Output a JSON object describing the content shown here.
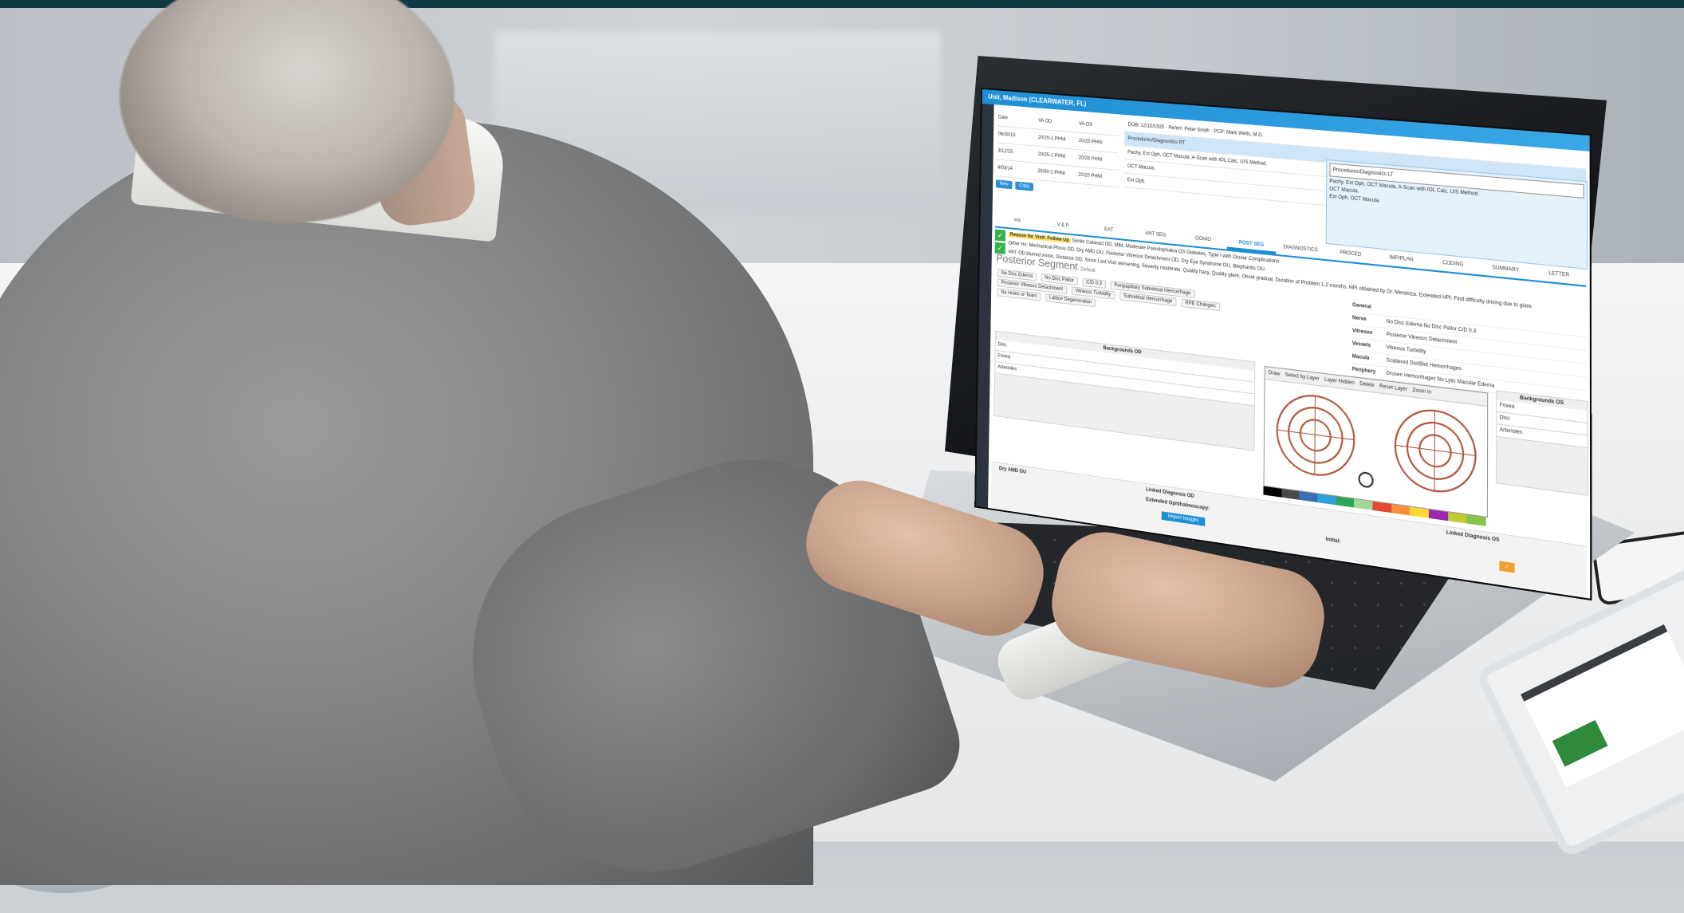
{
  "screen": {
    "title": "Unit, Madison (CLEARWATER, FL)",
    "history": {
      "headers": [
        "Date",
        "VA OD",
        "VA OS"
      ],
      "rows": [
        {
          "date": "06/30/15",
          "od": "20/20-1 PHNI",
          "os": "20/25 PHNI"
        },
        {
          "date": "3/12/15",
          "od": "20/25-1 PHNI",
          "os": "20/25 PHNI"
        },
        {
          "date": "4/03/14",
          "od": "20/30-2 PHNI",
          "os": "20/20 PHNI"
        }
      ],
      "new_label": "New",
      "copy_label": "Copy"
    },
    "patient": {
      "dob": "DOB: 12/10/1925",
      "referral": "Referr: Peter Smith",
      "pcp": "PCP: Mark Wells, M.D.",
      "procedures_rt": "Procedures/Diagnostics RT",
      "procedures_lt": "Procedures/Diagnostics LT"
    },
    "info_lines": [
      "Pachy, Ext Oph, OCT Macula, A-Scan with IOL Calc, U/S Method.",
      "OCT Macula.",
      "Ext Oph."
    ],
    "proc_text": [
      "Pachy, Ext Oph, OCT Macula, A-Scan with IOL Calc, U/S Method.",
      "OCT Macula.",
      "Ext Oph, OCT Macula."
    ],
    "tabs": [
      "HX",
      "V & P",
      "EXT",
      "ANT SEG",
      "GONIO",
      "POST SEG",
      "DIAGNOSTICS",
      "PROCED",
      "IMP/PLAN",
      "CODING",
      "SUMMARY",
      "LETTER"
    ],
    "active_tab": "POST SEG",
    "reason": {
      "label": "Reason for Visit: Follow Up",
      "items": "Senile Cataract OD, Mild, Moderate  Pseudophakia OS  Diabetes, Type I with Ocular Complications.",
      "other": "Other Hx: Mechanical Ptosis OD, Dry AMD OU, Posterior Vitreous Detachment OD, Dry Eye Syndrome OU, Blepharitis OU.",
      "hpi": "HPI: OD blurred vision, Distance OD, Since Last Visit worsening, Severity moderate, Quality hazy, Quality glare, Onset gradual, Duration of Problem 1-2 months. HPI obtained by Dr. Mendoza. Extended HPI: Find difficulty driving due to glare."
    },
    "segment_title": "Posterior Segment",
    "default_label": "Default",
    "chips": [
      "No Disc Edema",
      "No Disc Pallor",
      "C/D 0.3",
      "Peripapillary Subretinal Hemorrhage",
      "Posterior Vitreous Detachment",
      "Vitreous Turbidity",
      "Subretinal Hemorrhage",
      "RPE Changes",
      "No Holes or Tears",
      "Lattice Degeneration"
    ],
    "backgrounds_od": {
      "title": "Backgrounds OD",
      "lines": [
        "Disc",
        "Fovea",
        "Arterioles"
      ]
    },
    "backgrounds_os": {
      "title": "Backgrounds OS",
      "lines": [
        "Fovea",
        "Disc",
        "Arterioles"
      ]
    },
    "right_fields": [
      {
        "label": "General",
        "value": ""
      },
      {
        "label": "Nerve",
        "value": "No Disc Edema   No Disc Pallor   C/D 0.3"
      },
      {
        "label": "Vitreous",
        "value": "Posterior Vitreous Detachment"
      },
      {
        "label": "Vessels",
        "value": "Vitreous Turbidity"
      },
      {
        "label": "Macula",
        "value": "Scattered Dot/Blot Hemorrhages"
      },
      {
        "label": "Periphery",
        "value": "Drusen Hemorrhages   No Lytic   Macular Edema"
      }
    ],
    "draw_toolbar": [
      "Draw",
      "Select by Layer",
      "Layer Hidden",
      "Delete",
      "Reset Layer",
      "Zoom in"
    ],
    "bottom": {
      "linked_od": "Linked Diagnosis OD",
      "linked_os": "Linked Diagnosis OS",
      "dry_amd": "Dry AMD OU",
      "extended": "Extended Ophthalmoscopy:",
      "import_label": "Import Images",
      "initial_label": "Initial:"
    },
    "palette": [
      "#000000",
      "#4a4a4a",
      "#3a6fb5",
      "#2fa0d8",
      "#31a354",
      "#a1d99b",
      "#e34a33",
      "#fd8d3c",
      "#fdd835",
      "#9c27b0",
      "#c0ca33",
      "#8bc34a"
    ]
  }
}
